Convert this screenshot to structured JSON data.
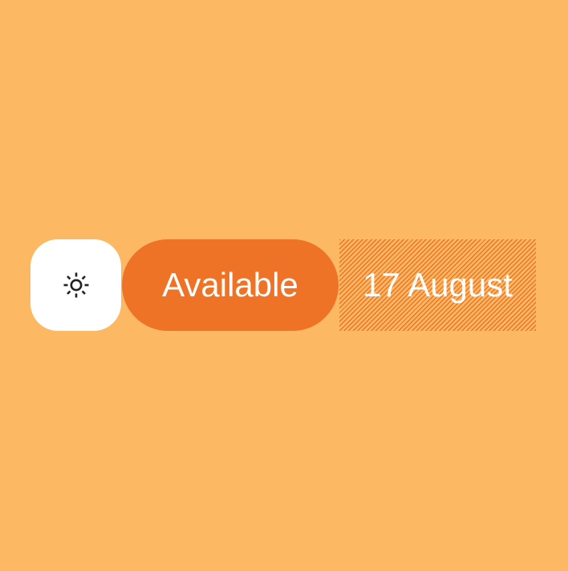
{
  "colors": {
    "background": "#FDB863",
    "accent": "#EE7326",
    "surface": "#FFFFFF",
    "icon": "#222222"
  },
  "toolbar": {
    "theme_icon": "sun-icon",
    "status_label": "Available",
    "date_label": "17 August"
  }
}
